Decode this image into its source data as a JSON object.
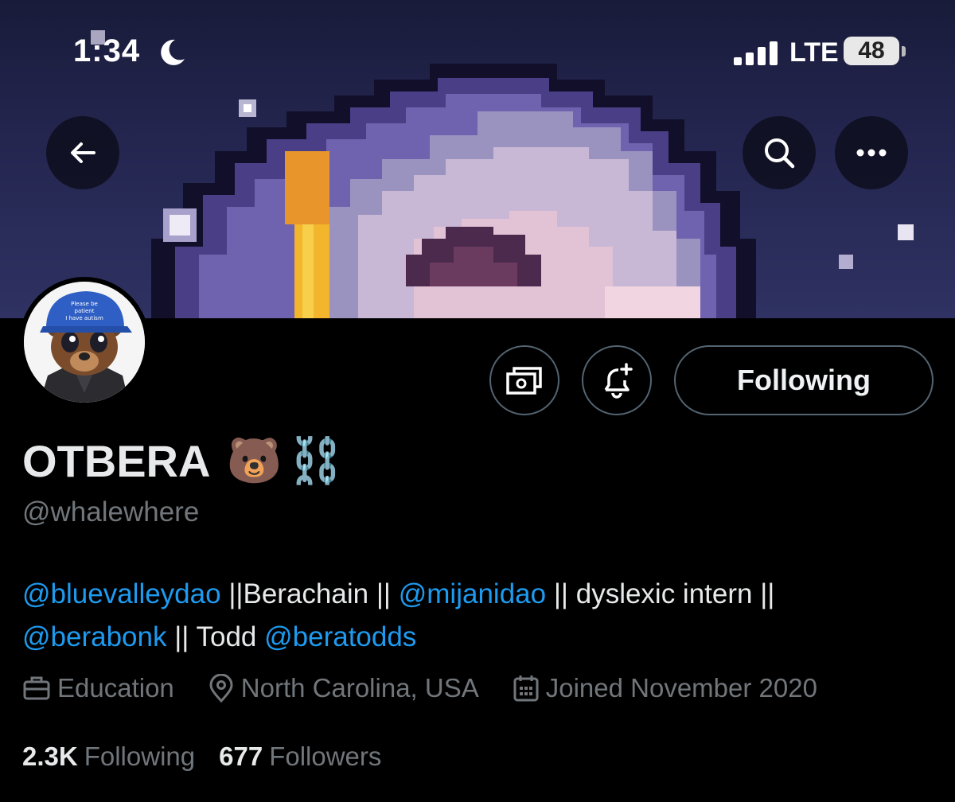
{
  "status_bar": {
    "time": "1:34",
    "network": "LTE",
    "battery": "48"
  },
  "profile": {
    "display_name": "OTBERA",
    "name_emojis": [
      "🐻",
      "⛓️"
    ],
    "handle": "@whalewhere",
    "avatar_cap_text": "Please be patient I have autism"
  },
  "buttons": {
    "following": "Following"
  },
  "bio": {
    "line1": [
      {
        "text": "@bluevalleydao",
        "link": true
      },
      {
        "text": " ||Berachain || ",
        "link": false
      },
      {
        "text": "@mijanidao",
        "link": true
      },
      {
        "text": " || dyslexic intern ||",
        "link": false
      }
    ],
    "line2": [
      {
        "text": "@berabonk",
        "link": true
      },
      {
        "text": " || Todd ",
        "link": false
      },
      {
        "text": "@beratodds",
        "link": true
      }
    ]
  },
  "meta": {
    "category": "Education",
    "location": "North Carolina, USA",
    "joined": "Joined November 2020"
  },
  "stats": {
    "following_count": "2.3K",
    "following_label": "Following",
    "followers_count": "677",
    "followers_label": "Followers"
  },
  "icons": {
    "back": "back-arrow-icon",
    "search": "search-icon",
    "more": "more-icon",
    "tip": "money-icon",
    "notify": "bell-plus-icon",
    "category": "briefcase-icon",
    "location": "location-pin-icon",
    "joined": "calendar-icon"
  }
}
